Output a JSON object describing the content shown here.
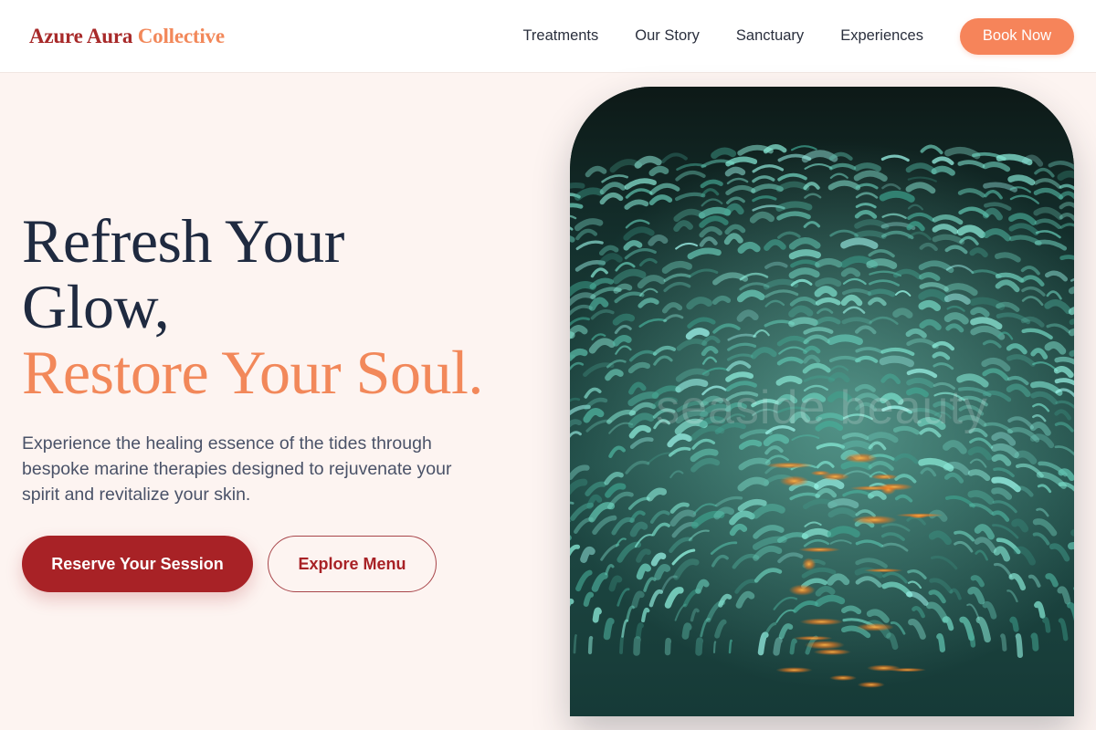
{
  "brand": {
    "name_primary": "Azure Aura",
    "name_accent": "Collective"
  },
  "nav": {
    "links": [
      "Treatments",
      "Our Story",
      "Sanctuary",
      "Experiences"
    ],
    "cta_label": "Book Now"
  },
  "hero": {
    "headline_line1": "Refresh Your",
    "headline_line2": "Glow,",
    "headline_accent": "Restore Your Soul.",
    "subtext": "Experience the healing essence of the tides through bespoke marine therapies designed to rejuvenate your spirit and revitalize your skin.",
    "primary_cta": "Reserve Your Session",
    "secondary_cta": "Explore Menu",
    "image_watermark": "seaside beauty"
  },
  "colors": {
    "brand_red": "#a82226",
    "brand_coral": "#f6845a",
    "heading_navy": "#1f2a40",
    "page_background": "#fdf4f1"
  }
}
